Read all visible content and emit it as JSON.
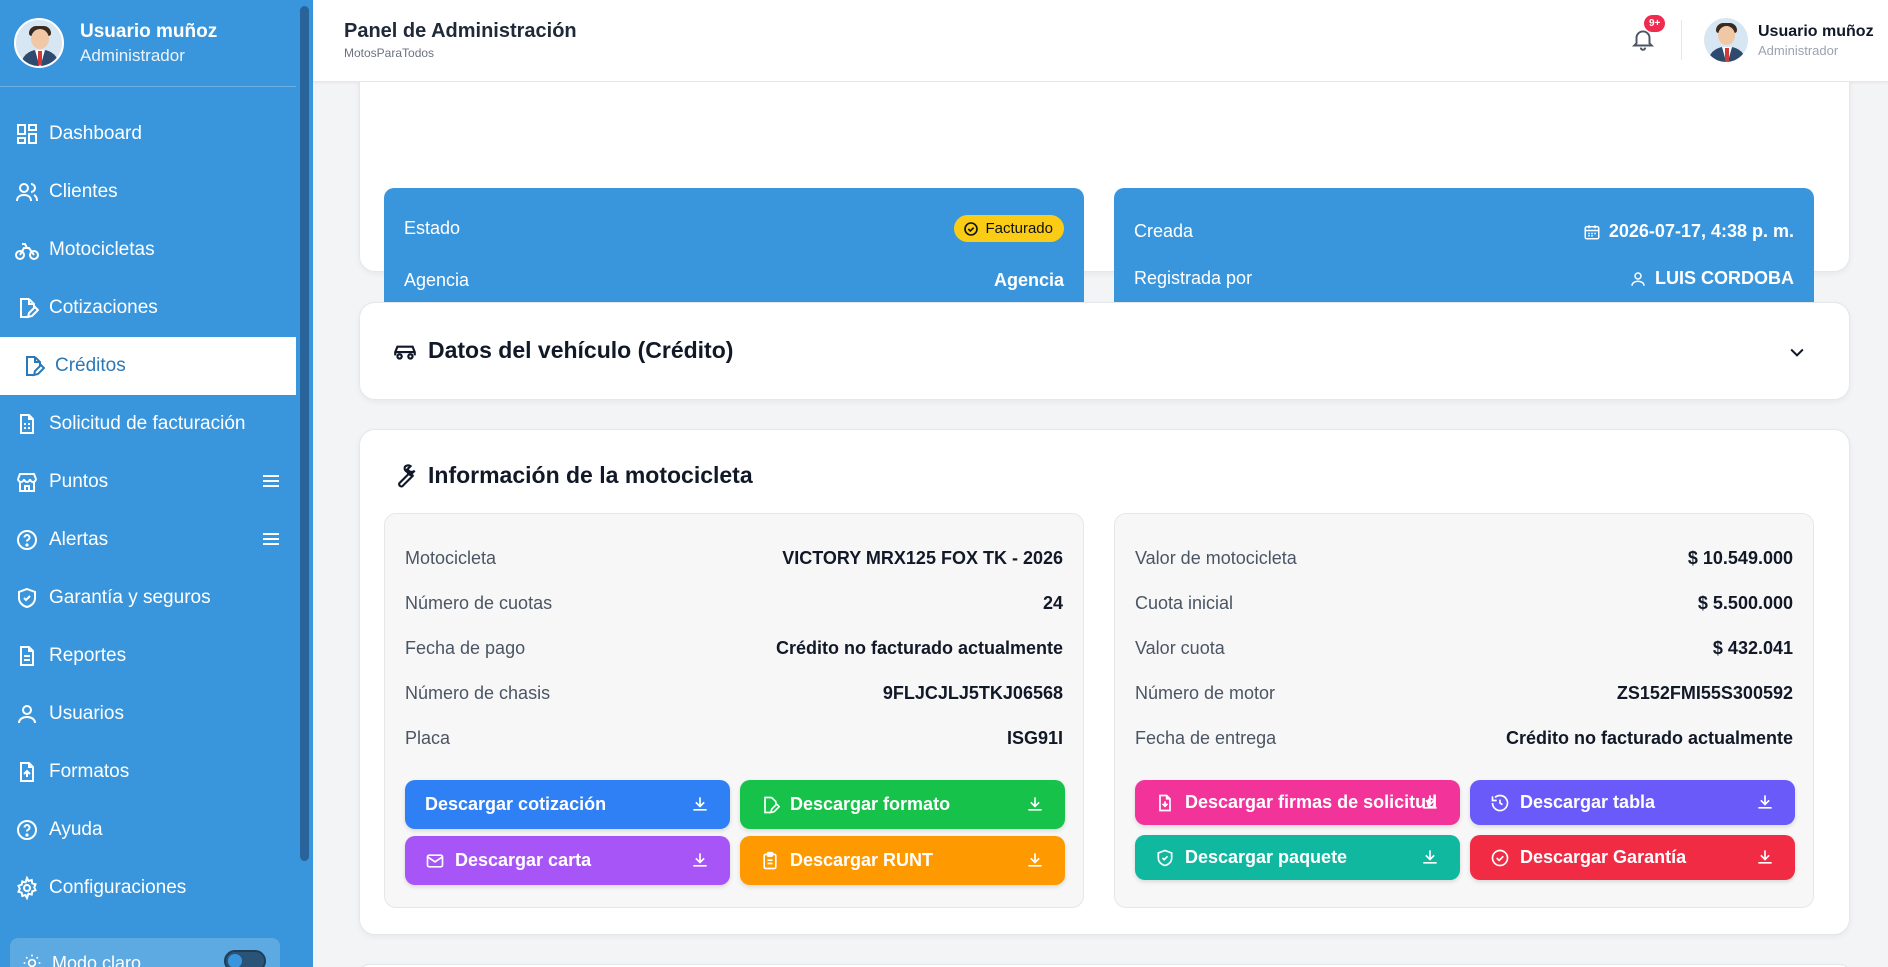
{
  "sidebar": {
    "user_name": "Usuario muñoz",
    "user_role": "Administrador",
    "items": [
      {
        "label": "Dashboard",
        "icon": "dashboard-icon"
      },
      {
        "label": "Clientes",
        "icon": "users-icon"
      },
      {
        "label": "Motocicletas",
        "icon": "bike-icon"
      },
      {
        "label": "Cotizaciones",
        "icon": "file-edit-icon"
      },
      {
        "label": "Créditos",
        "icon": "file-edit-icon",
        "active": true
      },
      {
        "label": "Solicitud de facturación",
        "icon": "invoice-icon"
      },
      {
        "label": "Puntos",
        "icon": "store-icon"
      },
      {
        "label": "Alertas",
        "icon": "help-circle-icon"
      },
      {
        "label": "Garantía y seguros",
        "icon": "shield-icon"
      },
      {
        "label": "Reportes",
        "icon": "file-text-icon"
      },
      {
        "label": "Usuarios",
        "icon": "user-icon"
      },
      {
        "label": "Formatos",
        "icon": "file-upload-icon"
      },
      {
        "label": "Ayuda",
        "icon": "help-circle-icon"
      },
      {
        "label": "Configuraciones",
        "icon": "gear-icon"
      }
    ],
    "theme_label": "Modo claro"
  },
  "header": {
    "title": "Panel de Administración",
    "subtitle": "MotosParaTodos",
    "notif_badge": "9+",
    "user_name": "Usuario muñoz",
    "user_role": "Administrador"
  },
  "status_card": {
    "estado_label": "Estado",
    "estado_value": "Facturado",
    "agencia_label": "Agencia",
    "agencia_value": "Agencia",
    "creada_label": "Creada",
    "creada_value": "2026-07-17, 4:38 p. m.",
    "registrada_label": "Registrada por",
    "registrada_value": "LUIS CORDOBA"
  },
  "vehicle_section": {
    "title": "Datos del vehículo (Crédito)"
  },
  "moto_section": {
    "title": "Información de la motocicleta",
    "left": [
      {
        "label": "Motocicleta",
        "value": "VICTORY MRX125 FOX TK - 2026"
      },
      {
        "label": "Número de cuotas",
        "value": "24"
      },
      {
        "label": "Fecha de pago",
        "value": "Crédito no facturado actualmente"
      },
      {
        "label": "Número de chasis",
        "value": "9FLJCJLJ5TKJ06568"
      },
      {
        "label": "Placa",
        "value": "ISG91I"
      }
    ],
    "right": [
      {
        "label": "Valor de motocicleta",
        "value": "$ 10.549.000"
      },
      {
        "label": "Cuota inicial",
        "value": "$ 5.500.000"
      },
      {
        "label": "Valor cuota",
        "value": "$ 432.041"
      },
      {
        "label": "Número de motor",
        "value": "ZS152FMI55S300592"
      },
      {
        "label": "Fecha de entrega",
        "value": "Crédito no facturado actualmente"
      }
    ],
    "buttons": {
      "cotizacion": "Descargar cotización",
      "formato": "Descargar formato",
      "carta": "Descargar carta",
      "runt": "Descargar RUNT",
      "firmas": "Descargar firmas de solicitud",
      "tabla": "Descargar tabla",
      "paquete": "Descargar paquete",
      "garantia": "Descargar Garantía"
    }
  },
  "colors": {
    "sidebar": "#3a96dc",
    "blue_btn": "#2f80f5",
    "green_btn": "#16c24a",
    "purple_btn": "#a855f7",
    "orange_btn": "#ff9900",
    "pink_btn": "#f1339a",
    "indigo_btn": "#6a5af9",
    "teal_btn": "#10b8a0",
    "red_btn": "#f22b45",
    "status_pill": "#facc15"
  }
}
